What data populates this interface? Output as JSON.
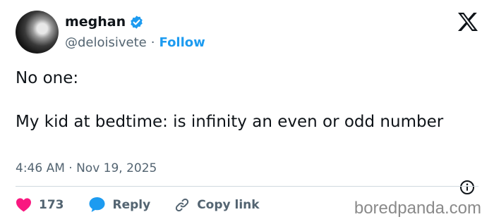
{
  "author": {
    "display_name": "meghan",
    "handle": "@deloisivete",
    "separator": "·",
    "follow_label": "Follow",
    "verified": true
  },
  "tweet": {
    "line1": "No one:",
    "line2": "My kid at bedtime: is infinity an even or odd number",
    "timestamp": "4:46 AM · Nov 19, 2025"
  },
  "actions": {
    "like_count": "173",
    "reply_label": "Reply",
    "copy_link_label": "Copy link"
  },
  "watermark": "boredpanda.com",
  "colors": {
    "accent": "#1d9bf0",
    "like": "#f91880",
    "text": "#0f1419",
    "muted": "#536471"
  },
  "icons": [
    "verified-badge-icon",
    "x-logo-icon",
    "info-icon",
    "heart-icon",
    "reply-bubble-icon",
    "link-icon"
  ]
}
